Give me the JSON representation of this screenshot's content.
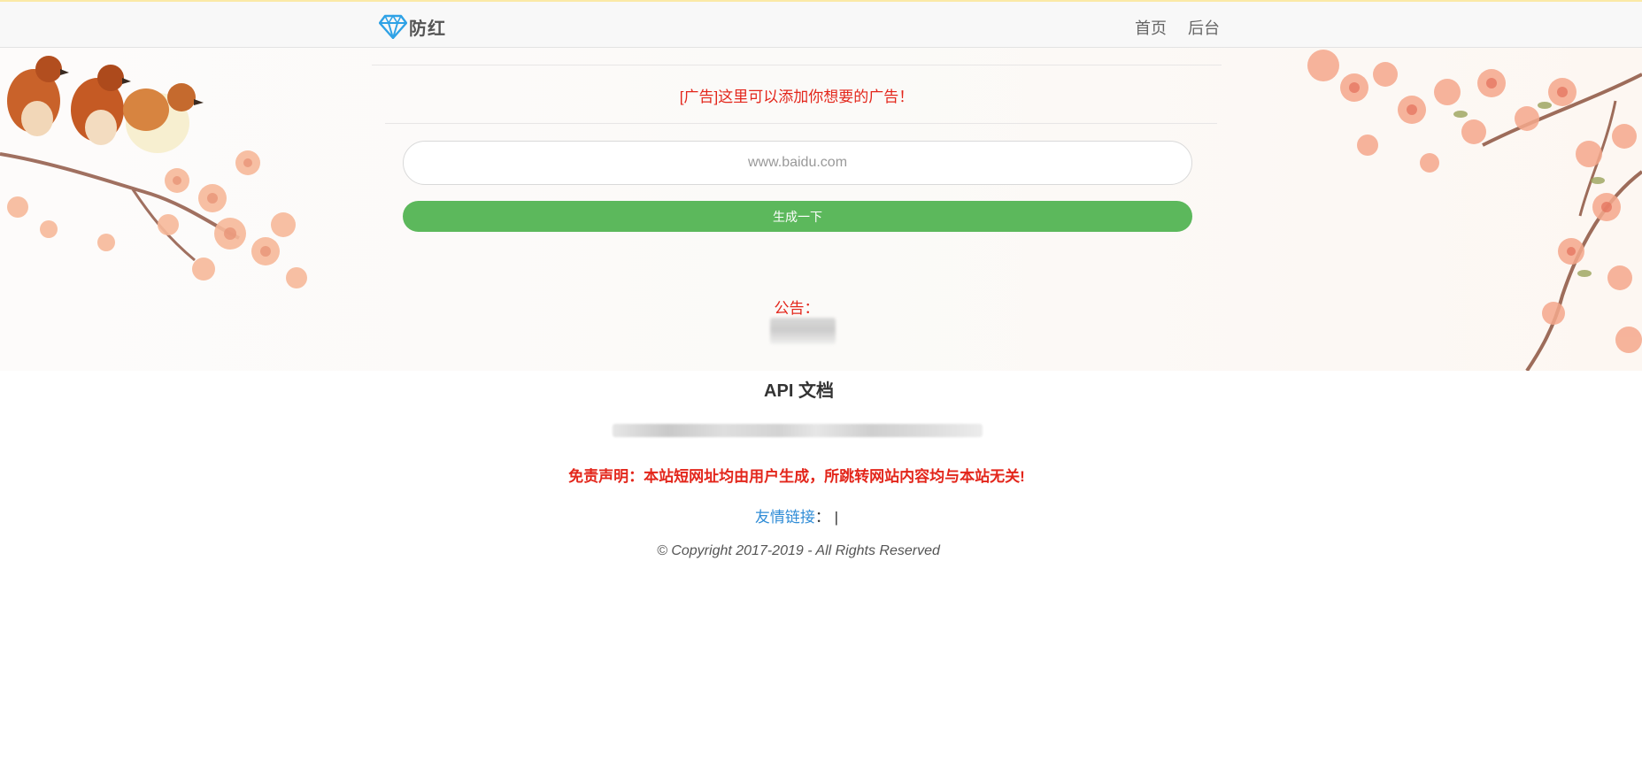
{
  "navbar": {
    "brand_text": "防红",
    "links": [
      {
        "label": "首页"
      },
      {
        "label": "后台"
      }
    ]
  },
  "hero": {
    "ad_text": "[广告]这里可以添加你想要的广告！",
    "url_input": {
      "value": "",
      "placeholder": "www.baidu.com"
    },
    "generate_button_label": "生成一下",
    "notice_label": "公告："
  },
  "api": {
    "title": "API 文档"
  },
  "footer": {
    "disclaimer": "免责声明：本站短网址均由用户生成，所跳转网站内容均与本站无关!",
    "friend_links_label": "友情链接",
    "friend_links_sep": "： |",
    "copyright": "© Copyright 2017-2019 - All Rights Reserved"
  },
  "colors": {
    "accent_red": "#e3261b",
    "button_green": "#5cb85c",
    "link_blue": "#2f8cd6",
    "brand_icon_blue": "#2fa2e6"
  },
  "icons": {
    "brand": "diamond-icon"
  }
}
